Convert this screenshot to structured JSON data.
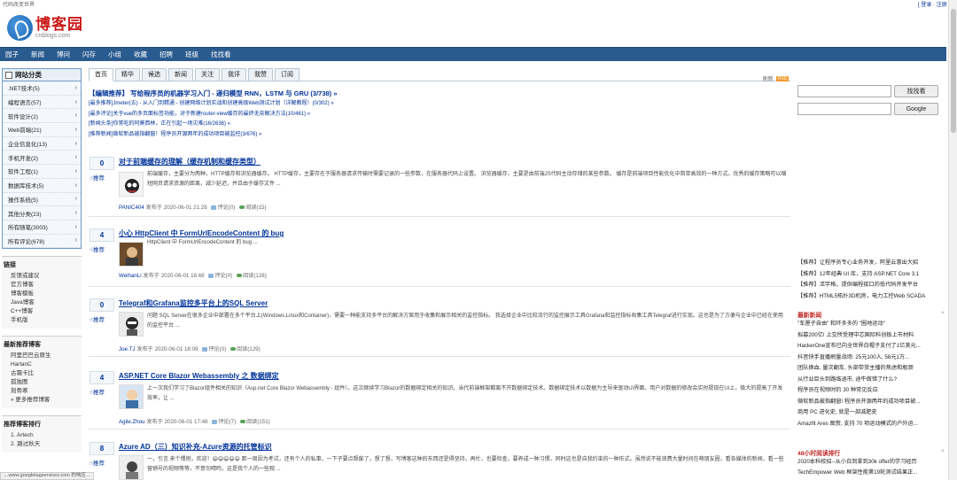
{
  "topbar": {
    "left": "代码改变世界",
    "login": "[ 登录 · 注册 ]"
  },
  "logo": {
    "name": "博客园",
    "domain": "cnblogs.com"
  },
  "nav": [
    "园子",
    "新闻",
    "博问",
    "闪存",
    "小组",
    "收藏",
    "招聘",
    "班级",
    "找找看"
  ],
  "categories": {
    "title": "网站分类",
    "items": [
      ".NET技术(5)",
      "编程语言(57)",
      "软件设计(2)",
      "Web前端(21)",
      "企业信息化(13)",
      "手机开发(2)",
      "软件工程(1)",
      "数据库技术(5)",
      "操作系统(5)",
      "其他分类(23)",
      "所有随笔(3003)",
      "所有评论(678)"
    ],
    "arrow": "›"
  },
  "links": {
    "title": "链接",
    "items": [
      "反馈或建议",
      "官方博客",
      "博客模板",
      "Java博客",
      "C++博客",
      "手机版"
    ]
  },
  "rec_bloggers": {
    "title": "最新推荐博客",
    "items": [
      "阿里巴巴云原生",
      "HarlanC",
      "古霜卡比",
      "孤独图",
      "刻骨寒",
      "» 更多推荐博客"
    ]
  },
  "rank": {
    "title": "推荐博客排行",
    "items": [
      "1. Artech",
      "2. 路过秋天",
      "3. ..."
    ]
  },
  "tabs": [
    "首页",
    "精华",
    "候选",
    "新闻",
    "关注",
    "我评",
    "我赞",
    "订阅"
  ],
  "refresh": "刷新",
  "rss": "RSS",
  "picks": {
    "main": "【编辑推荐】 写给程序员的机器学习入门 - 递归模型 RNN，LSTM 与 GRU (3/738) »",
    "items": [
      "[最多推荐]Jmeter(五) - 从入门到精通 - 创建网络计划实战和创建高级Web测试计划（详解教程）(0/302) »",
      "[最多评论]关于vue的多页面标签功能，对于新建router-view缓存的最终无奈解决方法(10/461) »",
      "[新闻头条]你常吃的阿莫西林，正在引起一场灾难(16/2636) »",
      "[推荐新闻]微软新品被指翻窗！程序员开源两年的成功项目被监控(3/676) »"
    ]
  },
  "digg_label": "推荐",
  "posts": [
    {
      "votes": "0",
      "title": "对于前端缓存的理解（缓存机制和缓存类型）",
      "body": "前端缓存，主要分为两种，HTTP缓存和浏览器缓存。 HTTP缓存，主要存在于服务器请求传输时需要记录的一些参数，在服务器代码上设置。 浏览器缓存，主要是由前端JS代码主动存储的某些参数。 缓存是前端项目性能优化中简单高效的一种方式。优秀的缓存策略可以缩短网页请求资源的距离，减少延迟，并且由于缓存文件 ...",
      "author": "PANIC404",
      "date": "发布于 2020-06-01 21:28",
      "comments": "评论(0)",
      "reads": "阅读(15)"
    },
    {
      "votes": "4",
      "title": "小心 HttpClient 中 FormUrlEncodeContent 的 bug",
      "body": "HttpClient 中 FormUrlEncodeContent 的 bug ...",
      "author": "WeihanLi",
      "date": "发布于 2020-06-01 18:48",
      "comments": "评论(0)",
      "reads": "阅读(128)"
    },
    {
      "votes": "0",
      "title": "Telegraf和Grafana监控多平台上的SQL Server",
      "body": "问题 SQL Server在很多企业中部署在多个平台上(Windows,Linux和Container)，需要一种能支持多平台的解决方案用于收集和展示相关的监控指标。 我选择企业中比较流行的监控展示工具Grafana和监控指标收集工具Telegraf进行实现。这也是为了方便与企业中已经在使用的监控平台 ...",
      "author": "Joe.TJ",
      "date": "发布于 2020-06-01 18:09",
      "comments": "评论(0)",
      "reads": "阅读(129)"
    },
    {
      "votes": "4",
      "title": "ASP.NET Core Blazor Webassembly 之 数据绑定",
      "body": "上一次我们学习了Blazor组件相关的知识（Asp.net Core Blazor Webassembly - 组件）。这次继续学习Blazor的数据绑定相关的知识。当代前端框架都离不开数据绑定技术。数据绑定技术以数据为主导来驱动UI界面，用户对数据的修改会实时提现在UI上，极大的提高了开发效率，让 ...",
      "author": "Agile.Zhou",
      "date": "发布于 2020-06-01 17:48",
      "comments": "评论(7)",
      "reads": "阅读(151)"
    },
    {
      "votes": "8",
      "title": "Azure AD（三）知识补充-Azure资源的托管标识",
      "body": "一，引言 来个惯例，欢迎！😄😄😄😄😄 距一周因为考试，还有个人的私事，一下子要点颓废了。想了想，写博客这种的东西还是得坚持，再忙，也要检查，要养成一种习惯，同时这也是自我约束的一种形式。虽然说不能浪费大量时间在萌朋友圈，看各媒体的新闻，看一些营销号的视频等等，不意勿晴鸣，这是我个人的一些观 ...",
      "author": "",
      "date": "",
      "comments": "",
      "reads": ""
    }
  ],
  "search": {
    "btn1": "找找看",
    "btn2": "Google"
  },
  "ads": [
    "【推荐】让程序员专心业务开发，阿里云惠出大招",
    "【推荐】12年经典 UI 库，支持 ASP.NET Core 3.1",
    "【推荐】活字格，提供编程接口的低代码开发平台",
    "【推荐】HTML5拓扑3D机房，电力工控Web SCADA"
  ],
  "news": {
    "title": "最新新闻",
    "close": "×",
    "items": [
      "\"车厘子自由\" 和环多多的 \"圈地运动\"",
      "拟募200亿! 上交所受理中芯国际科创板上市材料",
      "HackerOne宣布已向全世界白帽子支付了1亿美元...",
      "抖音快手直播刷量战场: 25元100人, 58元1万...",
      "团队换血, 量次翻车, 头部带货主播的焦虑和瓶颈",
      "从行业巨头到路临退市, 途牛做错了什么?",
      "程序员在视频时的 30 种常见反应",
      "微软新品被指翻窗! 程序员开源两年的成功项目被...",
      "商用 PC 进化史, 就是一部减肥史",
      "Amazfit Ares 图赏, 支持 70 项运动模式的户外运..."
    ]
  },
  "hot48": {
    "title": "48小时阅读排行",
    "close": "×",
    "items": [
      "2020本科校招--从小白到拿到30k offer的学习经历",
      "TechEmpower Web 框架性能第19轮测试结果正..."
    ]
  },
  "status_url": "…www.googletagservices.com 的响应…"
}
